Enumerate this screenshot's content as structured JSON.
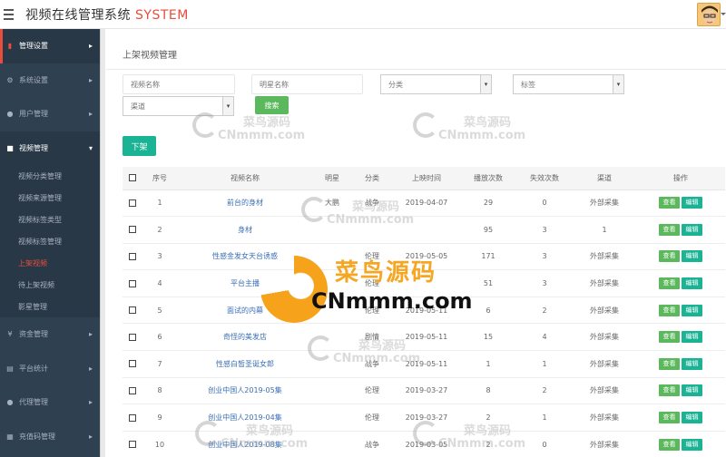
{
  "app": {
    "title": "视频在线管理系统",
    "title_accent": "SYSTEM"
  },
  "sidebar": {
    "items": [
      {
        "label": "管理设置",
        "icon": "book-icon",
        "active": true
      },
      {
        "label": "系统设置",
        "icon": "gear-icon"
      },
      {
        "label": "用户管理",
        "icon": "user-icon"
      },
      {
        "label": "视频管理",
        "icon": "video-icon",
        "open": true
      },
      {
        "label": "资金管理",
        "icon": "yen-icon"
      },
      {
        "label": "平台统计",
        "icon": "chart-icon"
      },
      {
        "label": "代理管理",
        "icon": "users-icon"
      },
      {
        "label": "充值码管理",
        "icon": "code-icon"
      }
    ],
    "submenu": [
      "视频分类管理",
      "视频来源管理",
      "视频标签类型",
      "视频标签管理",
      "上架视频",
      "待上架视频",
      "影星管理"
    ],
    "submenu_current": "上架视频"
  },
  "page": {
    "title": "上架视频管理",
    "filters": {
      "video_name_placeholder": "视频名称",
      "star_name_placeholder": "明星名称",
      "category_value": "分类",
      "tag_value": "标签",
      "channel_value": "渠道"
    },
    "search_label": "搜索",
    "down_label": "下架"
  },
  "table": {
    "headers": [
      "",
      "序号",
      "视频名称",
      "明星",
      "分类",
      "上映时间",
      "播放次数",
      "失效次数",
      "渠道",
      "操作"
    ],
    "view_label": "查看",
    "edit_label": "编辑",
    "rows": [
      {
        "no": "1",
        "name": "前台的身材",
        "star": "大鹏",
        "cat": "战争",
        "date": "2019-04-07",
        "plays": "29",
        "fails": "0",
        "channel": "外部采集"
      },
      {
        "no": "2",
        "name": "身材",
        "star": "",
        "cat": "",
        "date": "",
        "plays": "95",
        "fails": "3",
        "channel": "1"
      },
      {
        "no": "3",
        "name": "性感金发女天台诱惑",
        "star": "",
        "cat": "伦理",
        "date": "2019-05-05",
        "plays": "171",
        "fails": "3",
        "channel": "外部采集"
      },
      {
        "no": "4",
        "name": "平台主播",
        "star": "",
        "cat": "伦理",
        "date": "",
        "plays": "51",
        "fails": "3",
        "channel": "外部采集"
      },
      {
        "no": "5",
        "name": "面试的内幕",
        "star": "",
        "cat": "伦理",
        "date": "2019-05-11",
        "plays": "6",
        "fails": "2",
        "channel": "外部采集"
      },
      {
        "no": "6",
        "name": "奇怪的美发店",
        "star": "",
        "cat": "剧情",
        "date": "2019-05-11",
        "plays": "15",
        "fails": "4",
        "channel": "外部采集"
      },
      {
        "no": "7",
        "name": "性感白皙圣诞女郎",
        "star": "",
        "cat": "战争",
        "date": "2019-05-11",
        "plays": "1",
        "fails": "1",
        "channel": "外部采集"
      },
      {
        "no": "8",
        "name": "创业中国人2019-05集",
        "star": "",
        "cat": "伦理",
        "date": "2019-03-27",
        "plays": "8",
        "fails": "2",
        "channel": "外部采集"
      },
      {
        "no": "9",
        "name": "创业中国人2019-04集",
        "star": "",
        "cat": "伦理",
        "date": "2019-03-27",
        "plays": "2",
        "fails": "1",
        "channel": "外部采集"
      },
      {
        "no": "10",
        "name": "创业中国人2019-08集",
        "star": "",
        "cat": "战争",
        "date": "2019-03-05",
        "plays": "2",
        "fails": "0",
        "channel": "外部采集"
      }
    ]
  },
  "watermark": {
    "cn": "菜鸟源码",
    "en": "CNmmm.com"
  },
  "colors": {
    "sidebar_bg": "#2f4050",
    "accent_red": "#e74c3c",
    "green": "#5cb85c",
    "teal": "#1ab394"
  }
}
